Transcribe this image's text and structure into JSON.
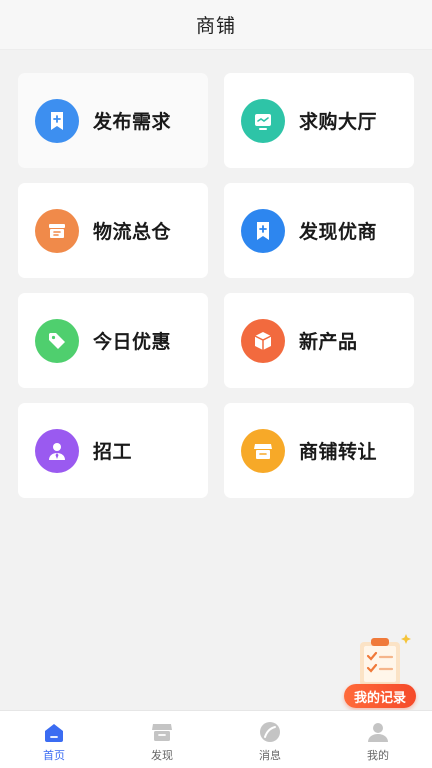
{
  "header": {
    "title": "商铺"
  },
  "cards": [
    {
      "label": "发布需求",
      "icon": "bookmark-plus-icon",
      "color": "#3d8ff0"
    },
    {
      "label": "求购大厅",
      "icon": "monitor-chart-icon",
      "color": "#2ec4a7"
    },
    {
      "label": "物流总仓",
      "icon": "warehouse-box-icon",
      "color": "#f08a4a"
    },
    {
      "label": "发现优商",
      "icon": "bookmark-plus-icon",
      "color": "#2d86ef"
    },
    {
      "label": "今日优惠",
      "icon": "price-tag-icon",
      "color": "#4fcf6e"
    },
    {
      "label": "新产品",
      "icon": "cube-icon",
      "color": "#f26a3e"
    },
    {
      "label": "招工",
      "icon": "worker-icon",
      "color": "#9a5af0"
    },
    {
      "label": "商铺转让",
      "icon": "shop-icon",
      "color": "#f7a928"
    }
  ],
  "float": {
    "label": "我的记录",
    "icon": "clipboard-check-icon"
  },
  "tabbar": {
    "items": [
      {
        "label": "首页",
        "icon": "home-icon",
        "active": true
      },
      {
        "label": "发现",
        "icon": "shop-icon",
        "active": false
      },
      {
        "label": "消息",
        "icon": "leaf-message-icon",
        "active": false
      },
      {
        "label": "我的",
        "icon": "user-icon",
        "active": false
      }
    ],
    "active_color": "#3b6cf2",
    "inactive_color": "#c4c4c4"
  }
}
